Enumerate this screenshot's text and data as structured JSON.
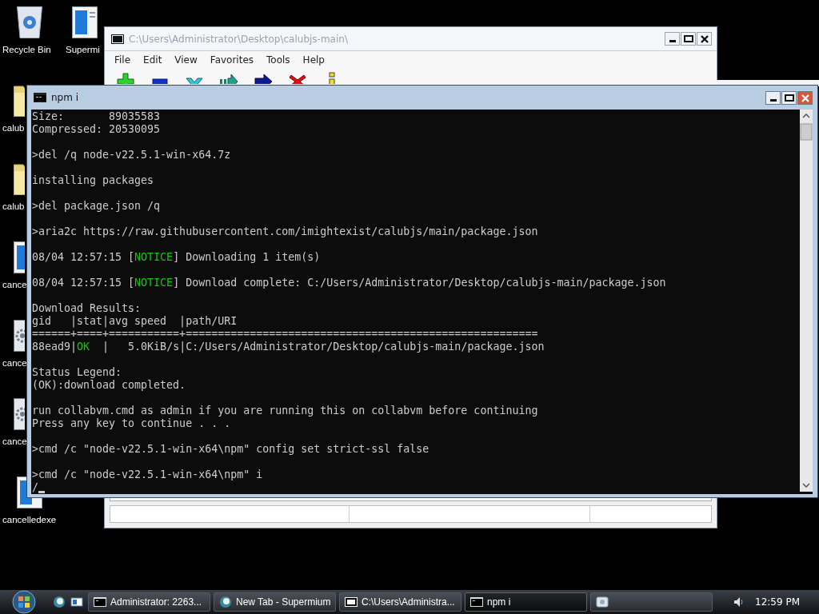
{
  "desktop_icons": [
    {
      "label": "Recycle Bin",
      "kind": "recycle"
    },
    {
      "label": "Supermi",
      "kind": "document"
    },
    {
      "label": "calub",
      "kind": "folder"
    },
    {
      "label": "calub",
      "kind": "folder"
    },
    {
      "label": "cance",
      "kind": "document"
    },
    {
      "label": "cance",
      "kind": "gear-doc"
    },
    {
      "label": "cance",
      "kind": "gear-doc"
    },
    {
      "label": "cancelledexe",
      "kind": "document"
    }
  ],
  "archive_window": {
    "title": "C:\\Users\\Administrator\\Desktop\\calubjs-main\\",
    "menu": [
      "File",
      "Edit",
      "View",
      "Favorites",
      "Tools",
      "Help"
    ],
    "toolbar": [
      {
        "kind": "add"
      },
      {
        "kind": "extract"
      },
      {
        "kind": "test"
      },
      {
        "kind": "copy"
      },
      {
        "kind": "move"
      },
      {
        "kind": "delete"
      },
      {
        "kind": "info"
      }
    ]
  },
  "console_window": {
    "title": "npm i",
    "blocks": [
      {
        "lines": [
          {
            "segments": [
              {
                "text": "Size:       89035583",
                "kind": "plain"
              }
            ]
          },
          {
            "segments": [
              {
                "text": "Compressed: 20530095",
                "kind": "plain"
              }
            ]
          }
        ]
      },
      {
        "lines": [
          {
            "segments": [
              {
                "text": ">del /q node-v22.5.1-win-x64.7z",
                "kind": "plain"
              }
            ]
          }
        ]
      },
      {
        "lines": [
          {
            "segments": [
              {
                "text": "installing packages",
                "kind": "plain"
              }
            ]
          }
        ]
      },
      {
        "lines": [
          {
            "segments": [
              {
                "text": ">del package.json /q",
                "kind": "plain"
              }
            ]
          }
        ]
      },
      {
        "lines": [
          {
            "segments": [
              {
                "text": ">aria2c https://raw.githubusercontent.com/imightexist/calubjs/main/package.json",
                "kind": "plain"
              }
            ]
          }
        ]
      },
      {
        "lines": [
          {
            "segments": [
              {
                "text": "08/04 12:57:15 [",
                "kind": "plain"
              },
              {
                "text": "NOTICE",
                "kind": "success"
              },
              {
                "text": "] Downloading 1 item(s)",
                "kind": "plain"
              }
            ]
          }
        ]
      },
      {
        "lines": [
          {
            "segments": [
              {
                "text": "08/04 12:57:15 [",
                "kind": "plain"
              },
              {
                "text": "NOTICE",
                "kind": "success"
              },
              {
                "text": "] Download complete: C:/Users/Administrator/Desktop/calubjs-main/package.json",
                "kind": "plain"
              }
            ]
          }
        ]
      },
      {
        "lines": [
          {
            "segments": [
              {
                "text": "Download Results:",
                "kind": "plain"
              }
            ]
          },
          {
            "segments": [
              {
                "text": "gid   |stat|avg speed  |path/URI",
                "kind": "plain"
              }
            ]
          },
          {
            "segments": [
              {
                "text": "======+====+===========+=======================================================",
                "kind": "plain"
              }
            ]
          },
          {
            "segments": [
              {
                "text": "88ead9|",
                "kind": "plain"
              },
              {
                "text": "OK",
                "kind": "success"
              },
              {
                "text": "  |   5.0KiB/s|C:/Users/Administrator/Desktop/calubjs-main/package.json",
                "kind": "plain"
              }
            ]
          }
        ]
      },
      {
        "lines": [
          {
            "segments": [
              {
                "text": "Status Legend:",
                "kind": "plain"
              }
            ]
          },
          {
            "segments": [
              {
                "text": "(OK):download completed.",
                "kind": "plain"
              }
            ]
          }
        ]
      },
      {
        "lines": [
          {
            "segments": [
              {
                "text": "run collabvm.cmd as admin if you are running this on collabvm before continuing",
                "kind": "plain"
              }
            ]
          },
          {
            "segments": [
              {
                "text": "Press any key to continue . . .",
                "kind": "plain"
              }
            ]
          }
        ]
      },
      {
        "lines": [
          {
            "segments": [
              {
                "text": ">cmd /c \"node-v22.5.1-win-x64\\npm\" config set strict-ssl false",
                "kind": "plain"
              }
            ]
          }
        ]
      },
      {
        "lines": [
          {
            "segments": [
              {
                "text": ">cmd /c \"node-v22.5.1-win-x64\\npm\" i",
                "kind": "plain"
              }
            ]
          },
          {
            "cursor": true,
            "segments": [
              {
                "text": "/",
                "kind": "plain"
              }
            ]
          }
        ]
      }
    ]
  },
  "taskbar": {
    "buttons": [
      {
        "label": "Administrator:  2263...",
        "kind": "console",
        "selected": false
      },
      {
        "label": "New Tab - Supermium",
        "kind": "browser",
        "selected": false
      },
      {
        "label": "C:\\Users\\Administra...",
        "kind": "archive",
        "selected": false
      },
      {
        "label": "npm i",
        "kind": "console",
        "selected": true
      },
      {
        "kind": "window",
        "selected": false
      }
    ],
    "clock": "12:59 PM"
  }
}
